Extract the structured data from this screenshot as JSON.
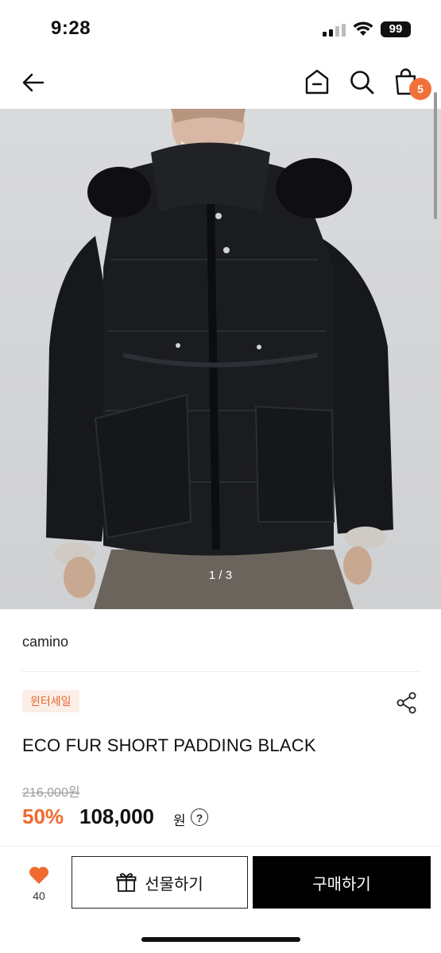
{
  "status_bar": {
    "time": "9:28",
    "battery": "99"
  },
  "nav": {
    "cart_count": "5"
  },
  "gallery": {
    "counter": "1 / 3"
  },
  "product": {
    "brand": "camino",
    "tag": "윈터세일",
    "title": "ECO FUR SHORT PADDING BLACK",
    "original_price": "216,000원",
    "discount": "50%",
    "price": "108,000",
    "currency": "원",
    "help_symbol": "?"
  },
  "actions": {
    "like_count": "40",
    "gift_label": "선물하기",
    "buy_label": "구매하기"
  },
  "colors": {
    "accent": "#ef6a2f",
    "tag_bg": "#fbeee6"
  },
  "icons": [
    "back-arrow-icon",
    "home-icon",
    "search-icon",
    "shopping-bag-icon",
    "share-icon",
    "heart-icon",
    "gift-icon",
    "help-icon"
  ]
}
